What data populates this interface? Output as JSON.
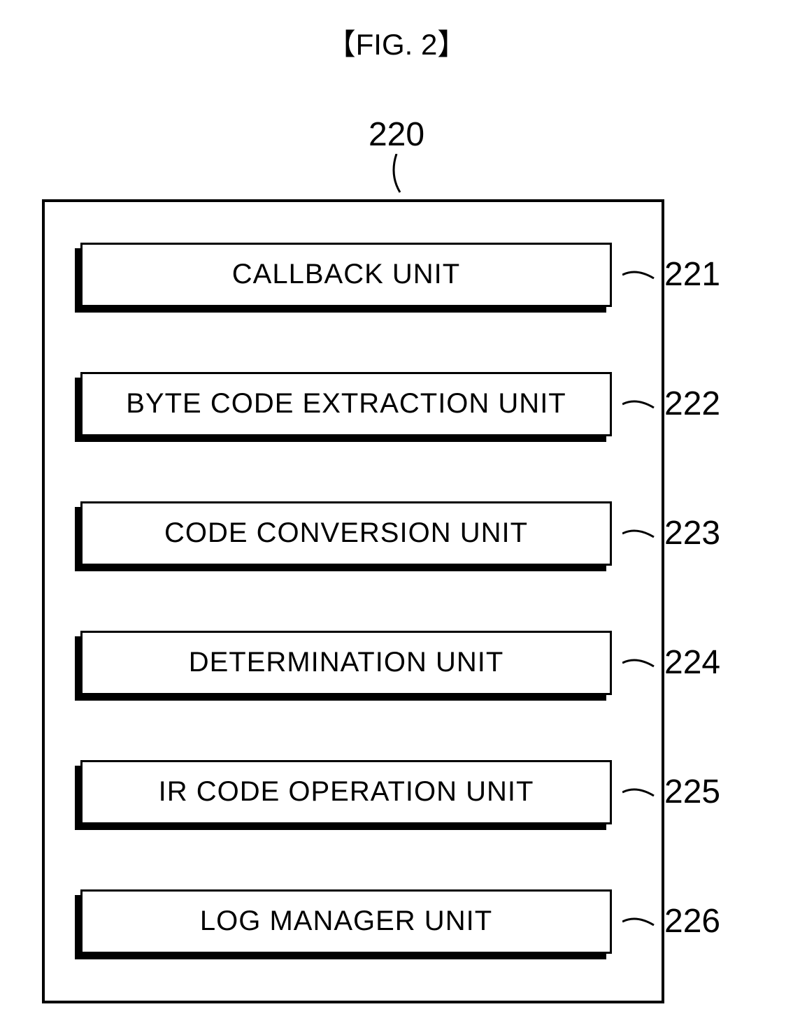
{
  "figure_title": "【FIG. 2】",
  "container_label": "220",
  "units": [
    {
      "name": "CALLBACK UNIT",
      "label": "221"
    },
    {
      "name": "BYTE CODE EXTRACTION UNIT",
      "label": "222"
    },
    {
      "name": "CODE CONVERSION UNIT",
      "label": "223"
    },
    {
      "name": "DETERMINATION UNIT",
      "label": "224"
    },
    {
      "name": "IR CODE OPERATION UNIT",
      "label": "225"
    },
    {
      "name": "LOG MANAGER UNIT",
      "label": "226"
    }
  ]
}
